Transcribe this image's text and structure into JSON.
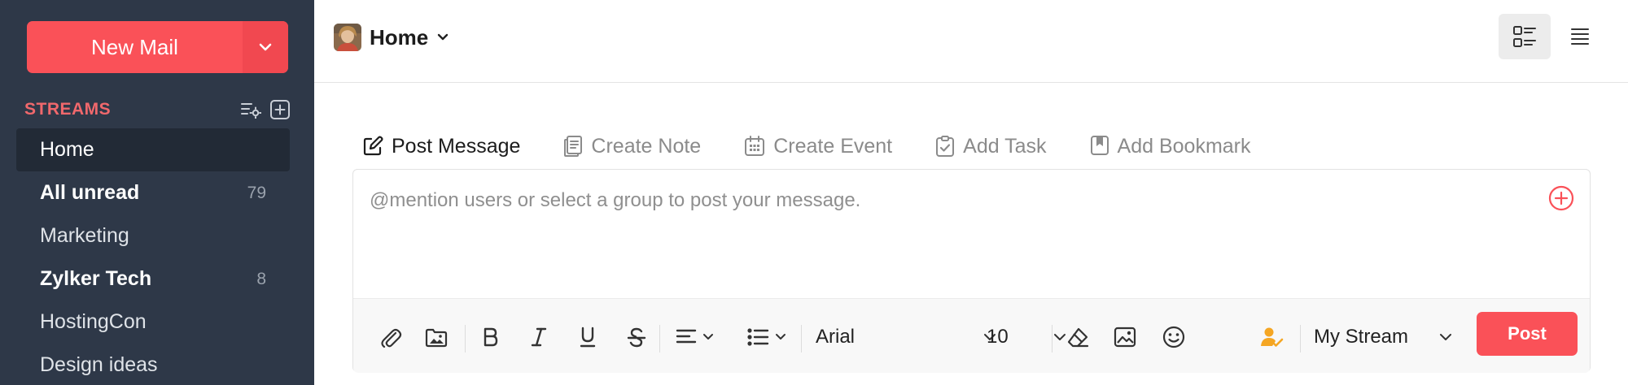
{
  "sidebar": {
    "new_mail_label": "New Mail",
    "streams_title": "STREAMS",
    "items": [
      {
        "label": "Home",
        "count": ""
      },
      {
        "label": "All unread",
        "count": "79"
      },
      {
        "label": "Marketing",
        "count": ""
      },
      {
        "label": "Zylker Tech",
        "count": "8"
      },
      {
        "label": "HostingCon",
        "count": ""
      },
      {
        "label": "Design ideas",
        "count": ""
      }
    ]
  },
  "header": {
    "title": "Home"
  },
  "composer": {
    "tabs": [
      {
        "label": "Post Message",
        "icon": "edit-icon"
      },
      {
        "label": "Create Note",
        "icon": "note-icon"
      },
      {
        "label": "Create Event",
        "icon": "calendar-icon"
      },
      {
        "label": "Add Task",
        "icon": "task-icon"
      },
      {
        "label": "Add Bookmark",
        "icon": "bookmark-icon"
      }
    ],
    "placeholder": "@mention users or select a group to post your message.",
    "font_family": "Arial",
    "font_size": "10",
    "stream_select": "My Stream",
    "post_label": "Post"
  },
  "colors": {
    "accent": "#fa5158",
    "sidebar_bg": "#2e3848",
    "streams_title": "#f0686c"
  }
}
